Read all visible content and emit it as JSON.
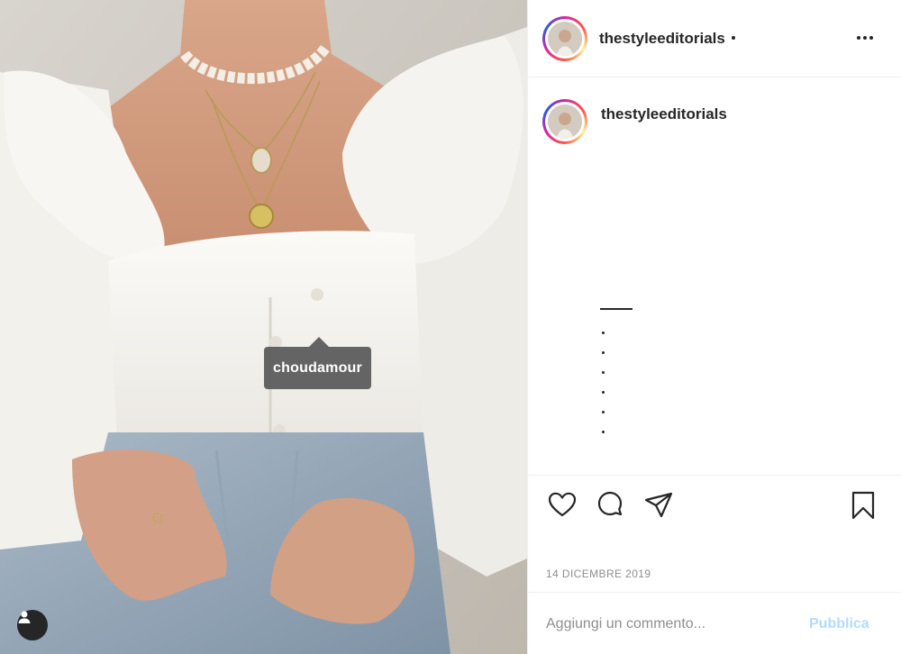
{
  "post": {
    "author": "thestyleeditorials",
    "photo_tag": "choudamour",
    "caption_author": "thestyleeditorials",
    "date": "14 DICEMBRE 2019"
  },
  "comment": {
    "placeholder": "Aggiungi un commento...",
    "publish_label": "Pubblica"
  },
  "icons": {
    "more": "more-options-icon",
    "like": "heart-icon",
    "comment": "comment-bubble-icon",
    "share": "paper-plane-icon",
    "save": "bookmark-icon",
    "tags": "user-tag-icon"
  },
  "colors": {
    "publish_disabled": "#b3dbff",
    "meta_text": "#8e8e8e",
    "primary_text": "#262626"
  }
}
